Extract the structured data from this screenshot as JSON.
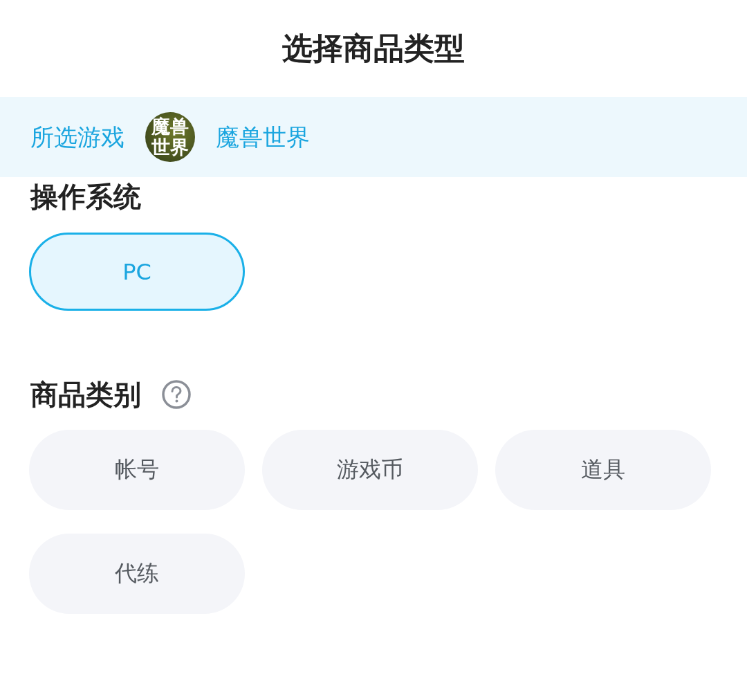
{
  "header": {
    "title": "选择商品类型"
  },
  "selected_game": {
    "label": "所选游戏",
    "logo_text": "魔兽世界",
    "name": "魔兽世界"
  },
  "sections": [
    {
      "title": "操作系统",
      "help": false,
      "options": [
        {
          "label": "PC",
          "selected": true
        }
      ]
    },
    {
      "title": "商品类别",
      "help": true,
      "options": [
        {
          "label": "帐号",
          "selected": false
        },
        {
          "label": "游戏币",
          "selected": false
        },
        {
          "label": "道具",
          "selected": false
        },
        {
          "label": "代练",
          "selected": false
        }
      ]
    }
  ]
}
